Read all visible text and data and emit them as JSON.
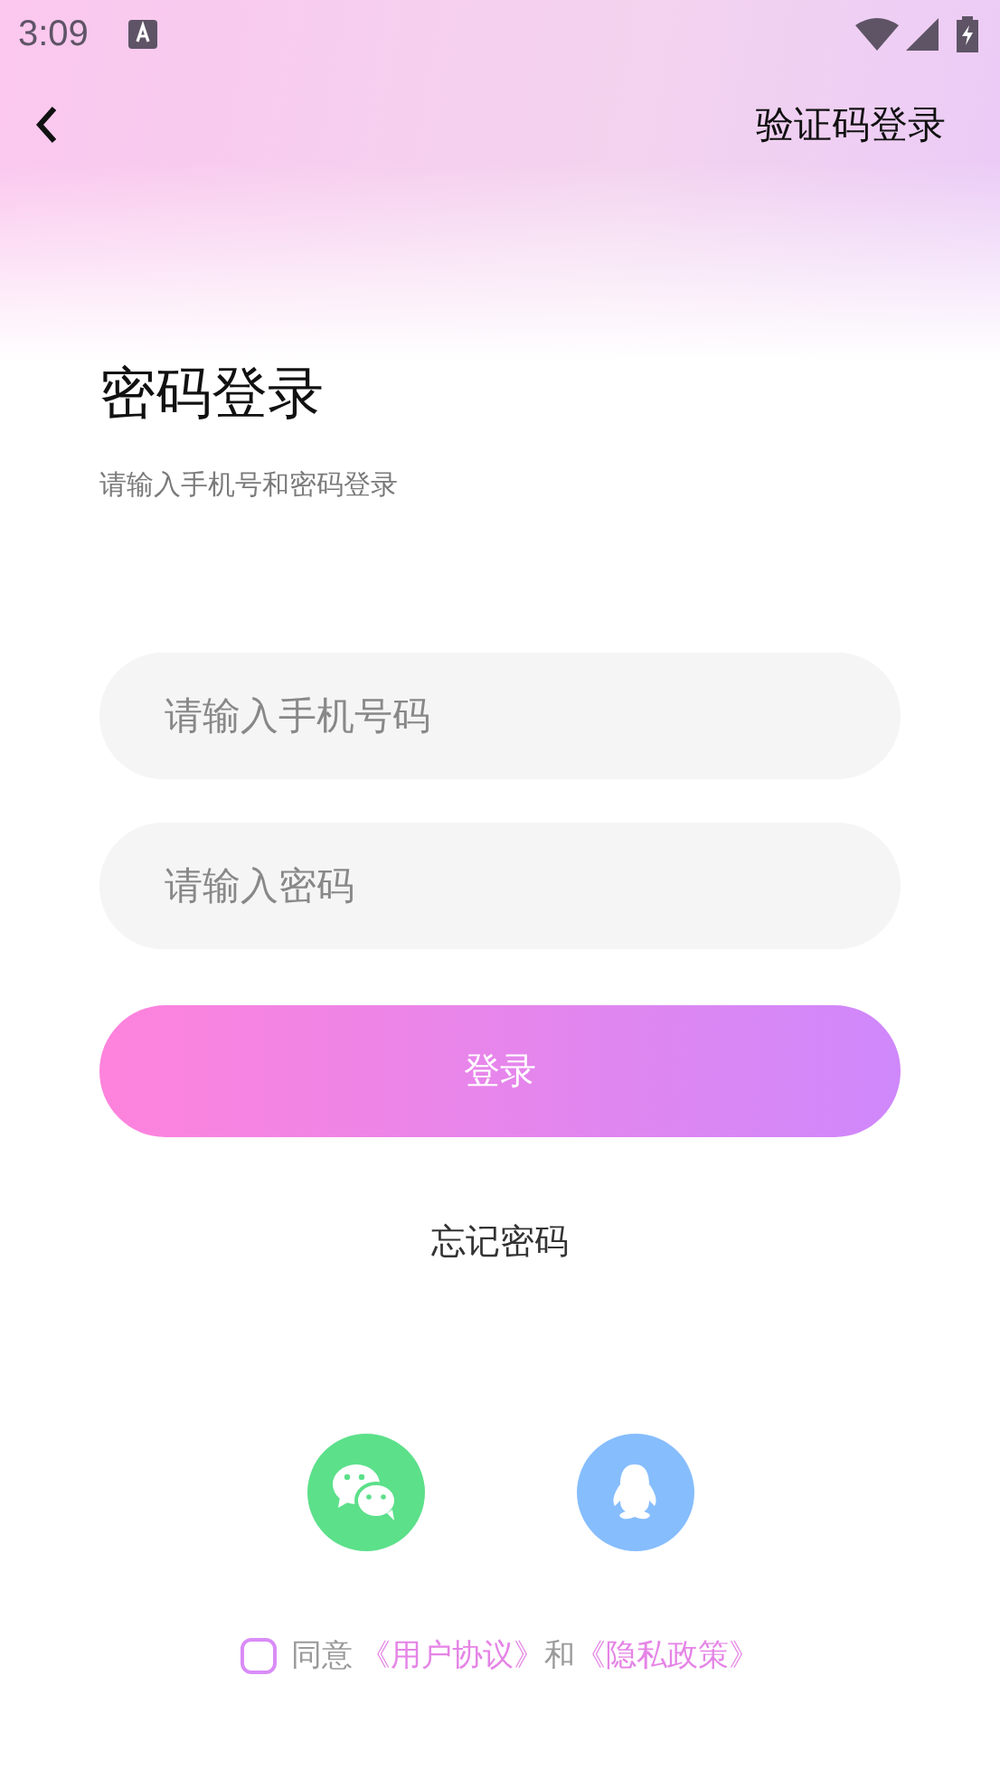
{
  "status_bar": {
    "time": "3:09"
  },
  "nav": {
    "action": "验证码登录"
  },
  "heading": {
    "title": "密码登录",
    "subtitle": "请输入手机号和密码登录"
  },
  "fields": [
    {
      "placeholder": "请输入手机号码"
    },
    {
      "placeholder": "请输入密码"
    }
  ],
  "login_button": "登录",
  "forgot_link": "忘记密码",
  "social": [
    {
      "kind": "wechat",
      "color": "#5ce08a"
    },
    {
      "kind": "qq",
      "color": "#86bdfd"
    }
  ],
  "agreement": {
    "checked": false,
    "prefix": "同意",
    "link1": "《用户协议》",
    "joiner": "和",
    "link2": "《隐私政策》"
  }
}
